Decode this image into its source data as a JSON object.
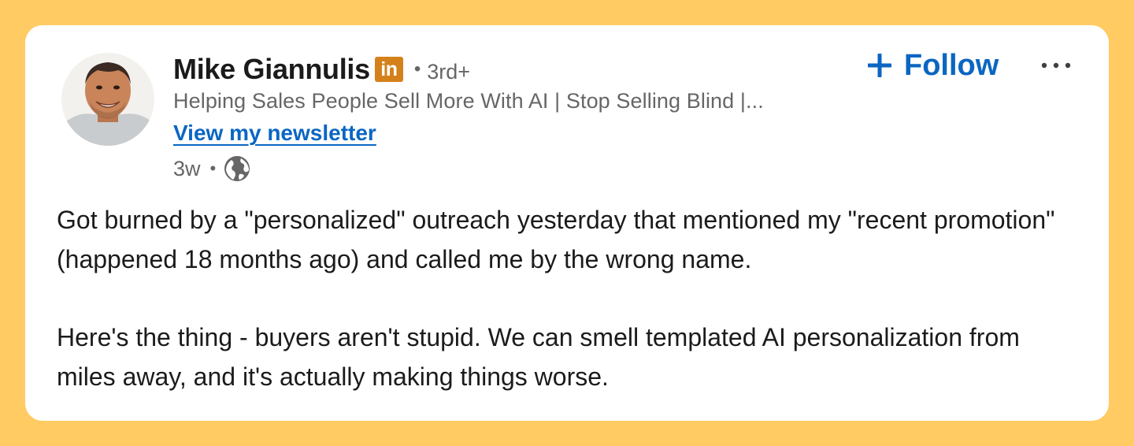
{
  "post": {
    "author": {
      "name": "Mike Giannulis",
      "badge": "in",
      "separator": "•",
      "degree": "3rd+",
      "headline": "Helping Sales People Sell More With AI | Stop Selling Blind |...",
      "newsletter_link": "View my newsletter"
    },
    "meta": {
      "time": "3w",
      "separator": "•",
      "visibility_icon": "globe-icon"
    },
    "actions": {
      "follow_label": "Follow",
      "follow_icon": "plus-icon",
      "more_icon": "more-options-icon"
    },
    "body": {
      "paragraphs": [
        "Got burned by a \"personalized\" outreach yesterday that mentioned my \"recent promotion\" (happened 18 months ago) and called me by the wrong name.",
        "Here's the thing - buyers aren't stupid. We can smell templated AI personalization from miles away, and it's actually making things worse."
      ]
    }
  },
  "colors": {
    "frame": "#FFCB62",
    "card": "#FFFFFF",
    "link_blue": "#0A66C2",
    "badge_orange": "#D4811B",
    "muted_text": "#666666",
    "main_text": "#1B1B1B"
  }
}
